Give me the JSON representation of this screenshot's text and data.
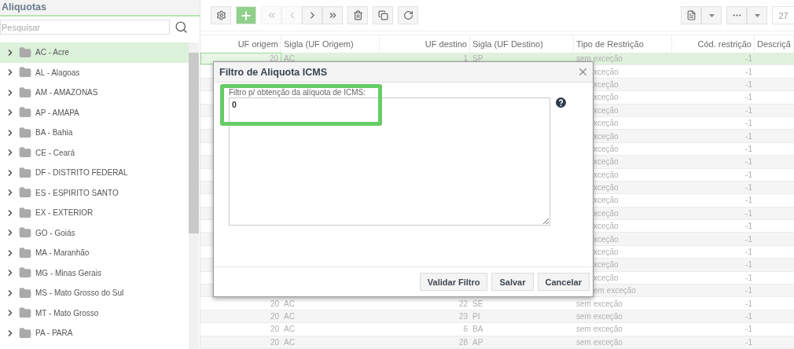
{
  "sidebar": {
    "title": "Aliquotas",
    "search": {
      "placeholder": "Pesquisar"
    },
    "items": [
      {
        "label": "AC - Acre",
        "selected": true
      },
      {
        "label": "AL - Alagoas",
        "selected": false
      },
      {
        "label": "AM - AMAZONAS",
        "selected": false
      },
      {
        "label": "AP - AMAPA",
        "selected": false
      },
      {
        "label": "BA - Bahia",
        "selected": false
      },
      {
        "label": "CE - Ceará",
        "selected": false
      },
      {
        "label": "DF - DISTRITO FEDERAL",
        "selected": false
      },
      {
        "label": "ES - ESPIRITO SANTO",
        "selected": false
      },
      {
        "label": "EX - EXTERIOR",
        "selected": false
      },
      {
        "label": "GO - Goiás",
        "selected": false
      },
      {
        "label": "MA - Maranhão",
        "selected": false
      },
      {
        "label": "MG - Minas Gerais",
        "selected": false
      },
      {
        "label": "MS - Mato Grosso do Sul",
        "selected": false
      },
      {
        "label": "MT - Mato Grosso",
        "selected": false
      },
      {
        "label": "PA - PARA",
        "selected": false
      }
    ]
  },
  "toolbar": {
    "buttons": [
      {
        "kind": "settings",
        "disabled": false
      },
      {
        "kind": "add",
        "disabled": false
      },
      {
        "kind": "first",
        "disabled": true
      },
      {
        "kind": "previous",
        "disabled": true
      },
      {
        "kind": "next",
        "disabled": false
      },
      {
        "kind": "last",
        "disabled": false
      },
      {
        "kind": "delete",
        "disabled": false
      },
      {
        "kind": "copy",
        "disabled": false
      },
      {
        "kind": "refresh",
        "disabled": false
      }
    ],
    "page_size": "27"
  },
  "table": {
    "columns": [
      "UF origem",
      "Sigla (UF Origem)",
      "UF destino",
      "Sigla (UF Destino)",
      "Tipo de Restrição",
      "Cód. restrição",
      "Descriçã"
    ],
    "rows": [
      {
        "selected": true,
        "cells": [
          "20",
          "AC",
          "1",
          "SP",
          "sem exceção",
          "-1"
        ]
      },
      {
        "selected": false,
        "cells": [
          "",
          "",
          "",
          "",
          "xceção",
          "-1"
        ]
      },
      {
        "selected": false,
        "cells": [
          "",
          "",
          "",
          "",
          "xceção",
          "-1"
        ]
      },
      {
        "selected": false,
        "cells": [
          "",
          "",
          "",
          "",
          "xceção",
          "-1"
        ]
      },
      {
        "selected": false,
        "cells": [
          "",
          "",
          "",
          "",
          "xceção",
          "-1"
        ]
      },
      {
        "selected": false,
        "cells": [
          "",
          "",
          "",
          "",
          "xceção",
          "-1"
        ]
      },
      {
        "selected": false,
        "cells": [
          "",
          "",
          "",
          "",
          "xceção",
          "-1"
        ]
      },
      {
        "selected": false,
        "cells": [
          "",
          "",
          "",
          "",
          "xceção",
          "-1"
        ]
      },
      {
        "selected": false,
        "cells": [
          "",
          "",
          "",
          "",
          "xceção",
          "-1"
        ]
      },
      {
        "selected": false,
        "cells": [
          "",
          "",
          "",
          "",
          "xceção",
          "-1"
        ]
      },
      {
        "selected": false,
        "cells": [
          "",
          "",
          "",
          "",
          "xceção",
          "-1"
        ]
      },
      {
        "selected": false,
        "cells": [
          "",
          "",
          "",
          "",
          "xceção",
          "-1"
        ]
      },
      {
        "selected": false,
        "cells": [
          "",
          "",
          "",
          "",
          "xceção",
          "-1"
        ]
      },
      {
        "selected": false,
        "cells": [
          "",
          "",
          "",
          "",
          "xceção",
          "-1"
        ]
      },
      {
        "selected": false,
        "cells": [
          "",
          "",
          "",
          "",
          "xceção",
          "-1"
        ]
      },
      {
        "selected": false,
        "cells": [
          "",
          "",
          "",
          "",
          "xceção",
          "-1"
        ]
      },
      {
        "selected": false,
        "cells": [
          "",
          "",
          "",
          "",
          "xceção",
          "-1"
        ]
      },
      {
        "selected": false,
        "cells": [
          "",
          "",
          "",
          "",
          "xceção",
          "-1"
        ]
      },
      {
        "selected": false,
        "cells": [
          "",
          "",
          "",
          "",
          "em exceção",
          "-1"
        ]
      },
      {
        "selected": false,
        "cells": [
          "20",
          "AC",
          "22",
          "SE",
          "sem exceção",
          "-1"
        ]
      },
      {
        "selected": false,
        "cells": [
          "20",
          "AC",
          "23",
          "PI",
          "sem exceção",
          "-1"
        ]
      },
      {
        "selected": false,
        "cells": [
          "20",
          "AC",
          "6",
          "BA",
          "sem exceção",
          "-1"
        ]
      },
      {
        "selected": false,
        "cells": [
          "20",
          "AC",
          "28",
          "AP",
          "sem exceção",
          "-1"
        ]
      }
    ]
  },
  "dialog": {
    "title": "Filtro de Aliquota ICMS",
    "field": {
      "label": "Filtro p/ obtenção da alíquota de ICMS:",
      "value": "0",
      "highlighted": true
    },
    "buttons": [
      "Validar Filtro",
      "Salvar",
      "Cancelar"
    ]
  }
}
